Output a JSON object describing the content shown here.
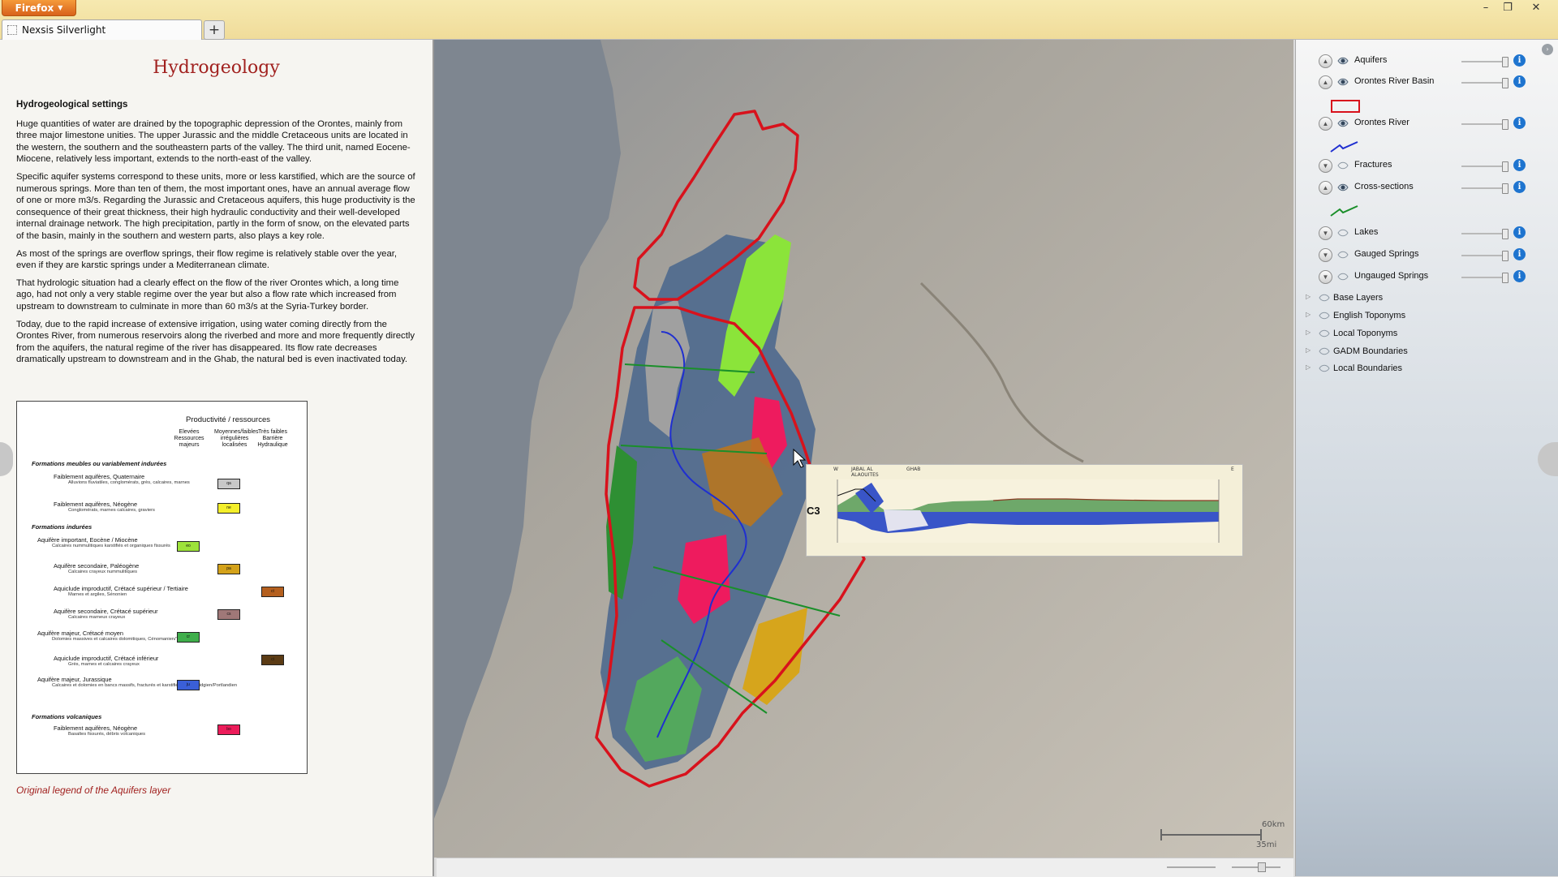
{
  "browser": {
    "menu_label": "Firefox",
    "tab_title": "Nexsis Silverlight",
    "new_tab": "+",
    "controls": {
      "minimize": "–",
      "restore": "❐",
      "close": "✕"
    }
  },
  "left_panel": {
    "title": "Hydrogeology",
    "section_heading": "Hydrogeological settings",
    "paragraphs": [
      "Huge quantities of water are drained by the topographic depression of the Orontes, mainly from three major limestone unities. The upper Jurassic and the middle Cretaceous units are located in the western, the southern and the southeastern parts of the valley. The third unit, named Eocene- Miocene, relatively less important, extends to the north-east of the valley.",
      "Specific aquifer systems correspond to these units, more or less karstified, which are the source of numerous springs. More than ten of them, the most important ones, have an annual average flow of one or more m3/s. Regarding the Jurassic and Cretaceous aquifers, this huge productivity is the consequence of their great thickness, their high hydraulic conductivity and their well-developed internal drainage network. The high precipitation, partly in the form of snow, on the elevated parts of the basin, mainly in the southern and western parts, also plays a key role.",
      "As most of the springs are overflow springs, their flow regime is relatively stable over the year, even if they are karstic springs under a Mediterranean climate.",
      "That hydrologic situation had a clearly effect on the flow of the river Orontes which, a long time ago, had not only a very stable regime over the year but also a flow rate which increased from upstream to downstream to culminate in more than 60 m3/s at the Syria-Turkey border.",
      "Today, due to the rapid increase of extensive irrigation, using water coming directly from the Orontes River, from numerous reservoirs along the riverbed and more and more frequently directly from the aquifers, the natural regime of the river has disappeared.  Its flow rate decreases dramatically upstream to downstream and in the Ghab, the natural bed is even inactivated today."
    ],
    "legend": {
      "title": "Productivité / ressources",
      "col1": "Elevées Ressources majeurs",
      "col2": "Moyennes/faibles irrégulières localisées",
      "col3": "Très faibles Barrière Hydraulique",
      "sections": {
        "s1": "Formations meubles ou variablement indurées",
        "s2": "Formations indurées",
        "s3": "Formations volcaniques"
      },
      "items": [
        {
          "label": "Faiblement aquifères, Quaternaire",
          "sub": "Alluvions fluviatiles, conglomérats, grès, calcaires, marnes",
          "code": "qa",
          "color": "#c8c8c8"
        },
        {
          "label": "Faiblement aquifères, Néogène",
          "sub": "Conglomérats, marnes calcaires, graviers",
          "code": "ne",
          "color": "#f4ef2a"
        },
        {
          "label": "Aquifère important, Eocène / Miocène",
          "sub": "Calcaires nummulitiques karstifiés et organiques fissurés",
          "code": "eo",
          "color": "#9de23a"
        },
        {
          "label": "Aquifère secondaire, Paléogène",
          "sub": "Calcaires crayeux nummulitiques",
          "code": "pa",
          "color": "#d4a21a"
        },
        {
          "label": "Aquiclude improductif, Crétacé supérieur / Tertiaire",
          "sub": "Marnes et argiles, Sénonien",
          "code": "ct",
          "color": "#b45f1e"
        },
        {
          "label": "Aquifère secondaire, Crétacé supérieur",
          "sub": "Calcaires marneux crayeux",
          "code": "cs",
          "color": "#a07878"
        },
        {
          "label": "Aquifère majeur, Crétacé moyen",
          "sub": "Dolomies massives et calcaires dolomitiques, Cénomanien/Turonien",
          "code": "cr",
          "color": "#3fae4b"
        },
        {
          "label": "Aquiclude improductif, Crétacé inférieur",
          "sub": "Grès, marnes et calcaires crayeux",
          "code": "ci",
          "color": "#5b3b14"
        },
        {
          "label": "Aquifère majeur, Jurassique",
          "sub": "Calcaires et dolomies en bancs massifs, fracturés et karstifiés, Kimméridgien/Portlandien",
          "code": "ju",
          "color": "#3a5fd8"
        },
        {
          "label": "Faiblement aquifères, Néogène",
          "sub": "Basaltes fissurés, débris volcaniques",
          "code": "bo",
          "color": "#ec1c5a"
        }
      ]
    },
    "legend_caption": "Original legend of the Aquifers layer"
  },
  "map": {
    "cross_section_label": "C3",
    "cross_section_w": "W",
    "cross_section_e": "E",
    "cross_section_place1": "JABAL AL ALAOUITES",
    "cross_section_place2": "GHAB",
    "scale_km": "60km",
    "scale_mi": "35mi"
  },
  "layers": [
    {
      "name": "Aquifers",
      "visible": true,
      "legend": null
    },
    {
      "name": "Orontes River Basin",
      "visible": true,
      "legend": "red-rect"
    },
    {
      "name": "Orontes River",
      "visible": true,
      "legend": "blue-line"
    },
    {
      "name": "Fractures",
      "visible": false,
      "legend": null
    },
    {
      "name": "Cross-sections",
      "visible": true,
      "legend": "green-line"
    },
    {
      "name": "Lakes",
      "visible": false,
      "legend": null
    },
    {
      "name": "Gauged Springs",
      "visible": false,
      "legend": null
    },
    {
      "name": "Ungauged Springs",
      "visible": false,
      "legend": null
    }
  ],
  "layer_groups": [
    "Base Layers",
    "English Toponyms",
    "Local Toponyms",
    "GADM Boundaries",
    "Local Boundaries"
  ],
  "colors": {
    "title_red": "#a1211f",
    "info_blue": "#1e74cf",
    "basin_red": "#d8121c",
    "river_blue": "#1f2fd0",
    "section_green": "#1a8f2a"
  }
}
